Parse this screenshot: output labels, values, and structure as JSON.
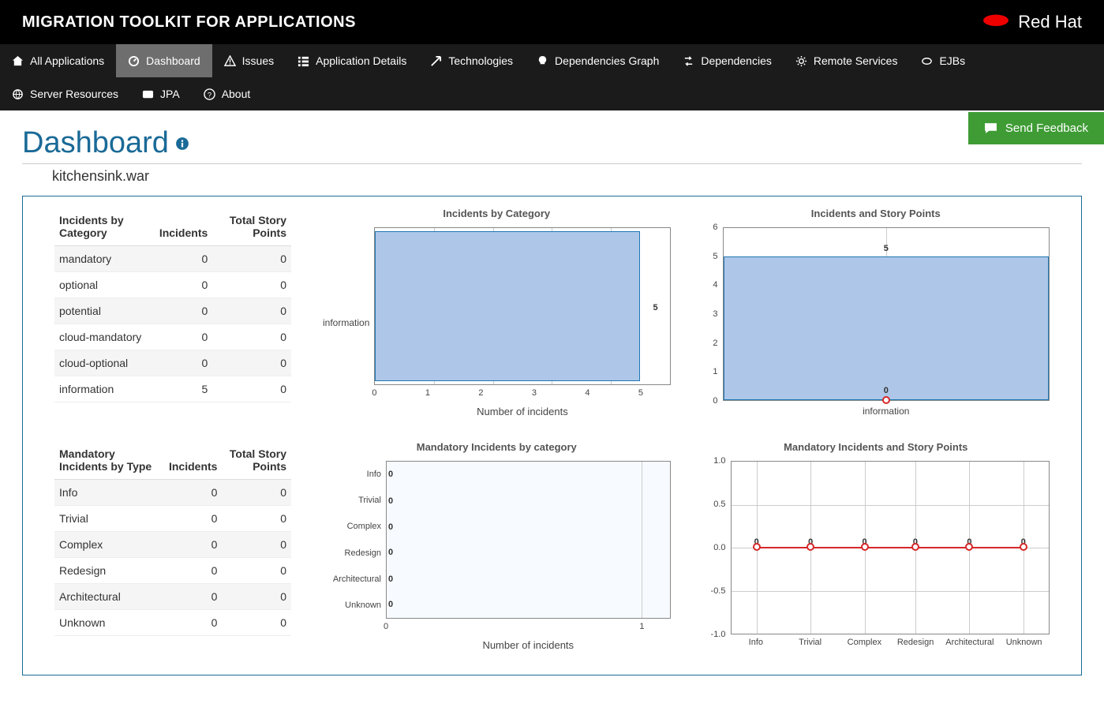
{
  "header": {
    "title": "MIGRATION TOOLKIT FOR APPLICATIONS",
    "brand": "Red Hat"
  },
  "nav": {
    "all_apps": "All Applications",
    "dashboard": "Dashboard",
    "issues": "Issues",
    "app_details": "Application Details",
    "technologies": "Technologies",
    "deps_graph": "Dependencies Graph",
    "dependencies": "Dependencies",
    "remote_services": "Remote Services",
    "ejbs": "EJBs",
    "server_resources": "Server Resources",
    "jpa": "JPA",
    "about": "About",
    "feedback": "Send Feedback"
  },
  "page": {
    "title": "Dashboard",
    "subtitle": "kitchensink.war"
  },
  "table1": {
    "h1": "Incidents by Category",
    "h2": "Incidents",
    "h3": "Total Story Points",
    "rows": [
      {
        "label": "mandatory",
        "incidents": "0",
        "points": "0"
      },
      {
        "label": "optional",
        "incidents": "0",
        "points": "0"
      },
      {
        "label": "potential",
        "incidents": "0",
        "points": "0"
      },
      {
        "label": "cloud-mandatory",
        "incidents": "0",
        "points": "0"
      },
      {
        "label": "cloud-optional",
        "incidents": "0",
        "points": "0"
      },
      {
        "label": "information",
        "incidents": "5",
        "points": "0"
      }
    ]
  },
  "table2": {
    "h1": "Mandatory Incidents by Type",
    "h2": "Incidents",
    "h3": "Total Story Points",
    "rows": [
      {
        "label": "Info",
        "incidents": "0",
        "points": "0"
      },
      {
        "label": "Trivial",
        "incidents": "0",
        "points": "0"
      },
      {
        "label": "Complex",
        "incidents": "0",
        "points": "0"
      },
      {
        "label": "Redesign",
        "incidents": "0",
        "points": "0"
      },
      {
        "label": "Architectural",
        "incidents": "0",
        "points": "0"
      },
      {
        "label": "Unknown",
        "incidents": "0",
        "points": "0"
      }
    ]
  },
  "chart1": {
    "title": "Incidents by Category",
    "xlabel": "Number of incidents",
    "ylabel": "information",
    "xticks": [
      "0",
      "1",
      "2",
      "3",
      "4",
      "5"
    ],
    "barvalue": "5"
  },
  "chart2": {
    "title": "Incidents and Story Points",
    "yticks": [
      "6",
      "5",
      "4",
      "3",
      "2",
      "1",
      "0"
    ],
    "xlabel": "information",
    "barlabel": "5",
    "pointlabel": "0"
  },
  "chart3": {
    "title": "Mandatory Incidents by category",
    "xlabel": "Number of incidents",
    "ylabels": [
      "Info",
      "Trivial",
      "Complex",
      "Redesign",
      "Architectural",
      "Unknown"
    ],
    "xticks": [
      "0",
      "1"
    ],
    "zero": "0"
  },
  "chart4": {
    "title": "Mandatory Incidents and Story Points",
    "yticks": [
      "1.0",
      "0.5",
      "0.0",
      "-0.5",
      "-1.0"
    ],
    "xlabels": [
      "Info",
      "Trivial",
      "Complex",
      "Redesign",
      "Architectural",
      "Unknown"
    ],
    "zero": "0"
  },
  "chart_data": [
    {
      "type": "bar",
      "title": "Incidents by Category",
      "orientation": "horizontal",
      "categories": [
        "information"
      ],
      "values": [
        5
      ],
      "xlabel": "Number of incidents",
      "xlim": [
        0,
        5
      ]
    },
    {
      "type": "bar+line",
      "title": "Incidents and Story Points",
      "categories": [
        "information"
      ],
      "series": [
        {
          "name": "Incidents",
          "type": "bar",
          "values": [
            5
          ]
        },
        {
          "name": "Story Points",
          "type": "line",
          "values": [
            0
          ]
        }
      ],
      "ylim": [
        0,
        6
      ]
    },
    {
      "type": "bar",
      "title": "Mandatory Incidents by category",
      "orientation": "horizontal",
      "categories": [
        "Info",
        "Trivial",
        "Complex",
        "Redesign",
        "Architectural",
        "Unknown"
      ],
      "values": [
        0,
        0,
        0,
        0,
        0,
        0
      ],
      "xlabel": "Number of incidents",
      "xlim": [
        0,
        1
      ]
    },
    {
      "type": "bar+line",
      "title": "Mandatory Incidents and Story Points",
      "categories": [
        "Info",
        "Trivial",
        "Complex",
        "Redesign",
        "Architectural",
        "Unknown"
      ],
      "series": [
        {
          "name": "Incidents",
          "type": "bar",
          "values": [
            0,
            0,
            0,
            0,
            0,
            0
          ]
        },
        {
          "name": "Story Points",
          "type": "line",
          "values": [
            0,
            0,
            0,
            0,
            0,
            0
          ]
        }
      ],
      "ylim": [
        -1.0,
        1.0
      ]
    }
  ]
}
